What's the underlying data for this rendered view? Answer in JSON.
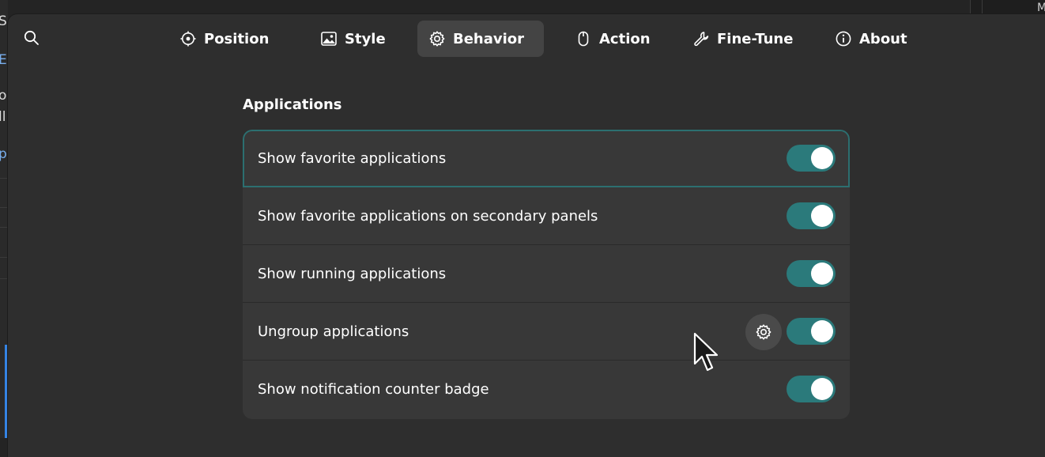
{
  "background": {
    "left_fragments": [
      "Sh",
      "E",
      "os",
      "ll",
      "p"
    ],
    "right_fragment": "M"
  },
  "search": {
    "icon": "search-icon"
  },
  "tabs": [
    {
      "label": "Position",
      "icon": "position-icon",
      "active": false
    },
    {
      "label": "Style",
      "icon": "image-icon",
      "active": false
    },
    {
      "label": "Behavior",
      "icon": "gear-icon",
      "active": true
    },
    {
      "label": "Action",
      "icon": "mouse-icon",
      "active": false
    },
    {
      "label": "Fine-Tune",
      "icon": "tools-icon",
      "active": false
    },
    {
      "label": "About",
      "icon": "info-icon",
      "active": false
    }
  ],
  "section": {
    "title": "Applications"
  },
  "rows": [
    {
      "label": "Show favorite applications",
      "enabled": true
    },
    {
      "label": "Show favorite applications on secondary panels",
      "enabled": true
    },
    {
      "label": "Show running applications",
      "enabled": true
    },
    {
      "label": "Ungroup applications",
      "enabled": true,
      "has_settings": true
    },
    {
      "label": "Show notification counter badge",
      "enabled": true
    }
  ],
  "colors": {
    "accent": "#2b7a7b",
    "focus_ring": "#2c6f70",
    "window_bg": "#2e2e2e",
    "card_bg": "#383838",
    "active_tab_bg": "#444444"
  }
}
